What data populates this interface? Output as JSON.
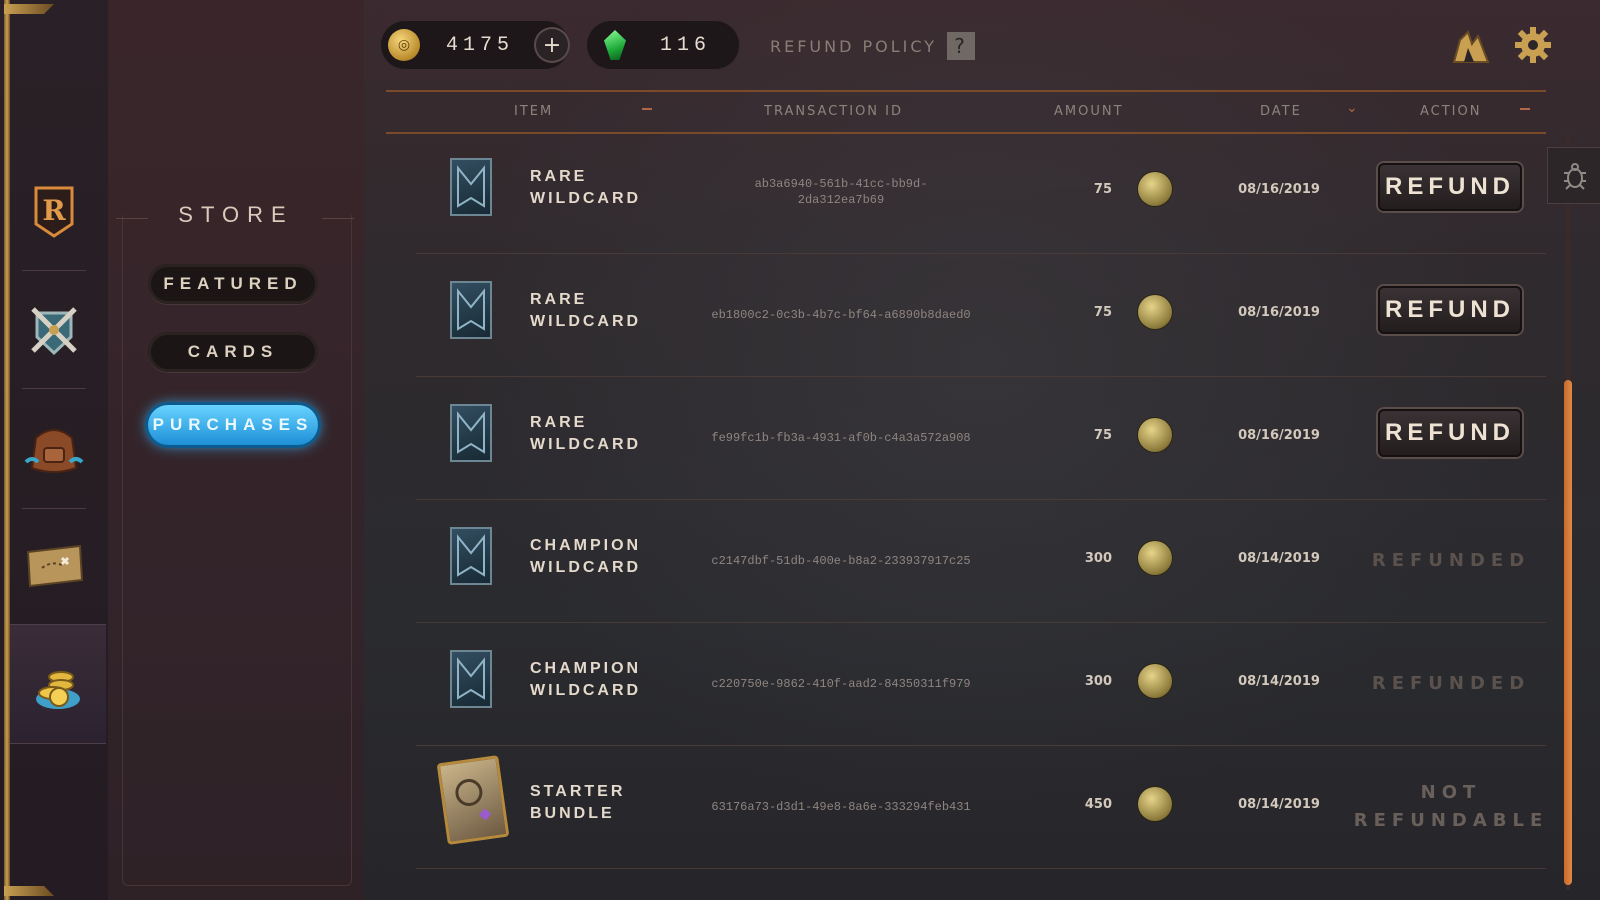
{
  "rail": {
    "items": [
      {
        "name": "logo-r",
        "label": "R"
      },
      {
        "name": "play"
      },
      {
        "name": "collection"
      },
      {
        "name": "journey"
      },
      {
        "name": "store"
      }
    ]
  },
  "subnav": {
    "title": "STORE",
    "buttons": [
      "FEATURED",
      "CARDS",
      "PURCHASES"
    ],
    "active": "PURCHASES"
  },
  "currency": {
    "coins": "4175",
    "coin_symbol": "◎",
    "plus": "+",
    "shards": "116"
  },
  "refund_policy": {
    "label": "REFUND POLICY",
    "help": "?"
  },
  "table": {
    "headers": [
      "ITEM",
      "TRANSACTION ID",
      "AMOUNT",
      "DATE",
      "ACTION"
    ],
    "sort_chevron": "⌄",
    "rows": [
      {
        "item": "RARE\nWILDCARD",
        "txid": "ab3a6940-561b-41cc-bb9d-\n2da312ea7b69",
        "amount": "75",
        "date": "08/16/2019",
        "action": "REFUND",
        "type": "button"
      },
      {
        "item": "RARE\nWILDCARD",
        "txid": "eb1800c2-0c3b-4b7c-bf64-a6890b8daed0",
        "amount": "75",
        "date": "08/16/2019",
        "action": "REFUND",
        "type": "button"
      },
      {
        "item": "RARE\nWILDCARD",
        "txid": "fe99fc1b-fb3a-4931-af0b-c4a3a572a908",
        "amount": "75",
        "date": "08/16/2019",
        "action": "REFUND",
        "type": "button"
      },
      {
        "item": "CHAMPION\nWILDCARD",
        "txid": "c2147dbf-51db-400e-b8a2-233937917c25",
        "amount": "300",
        "date": "08/14/2019",
        "action": "REFUNDED",
        "type": "status"
      },
      {
        "item": "CHAMPION\nWILDCARD",
        "txid": "c220750e-9862-410f-aad2-84350311f979",
        "amount": "300",
        "date": "08/14/2019",
        "action": "REFUNDED",
        "type": "status"
      },
      {
        "item": "STARTER\nBUNDLE",
        "txid": "63176a73-d3d1-49e8-8a6e-333294feb431",
        "amount": "450",
        "date": "08/14/2019",
        "action": "NOT\nREFUNDABLE",
        "type": "status"
      }
    ]
  },
  "colors": {
    "accent_orange": "#c96a2e",
    "active_blue": "#2fa8f0",
    "gold": "#c9a052"
  }
}
